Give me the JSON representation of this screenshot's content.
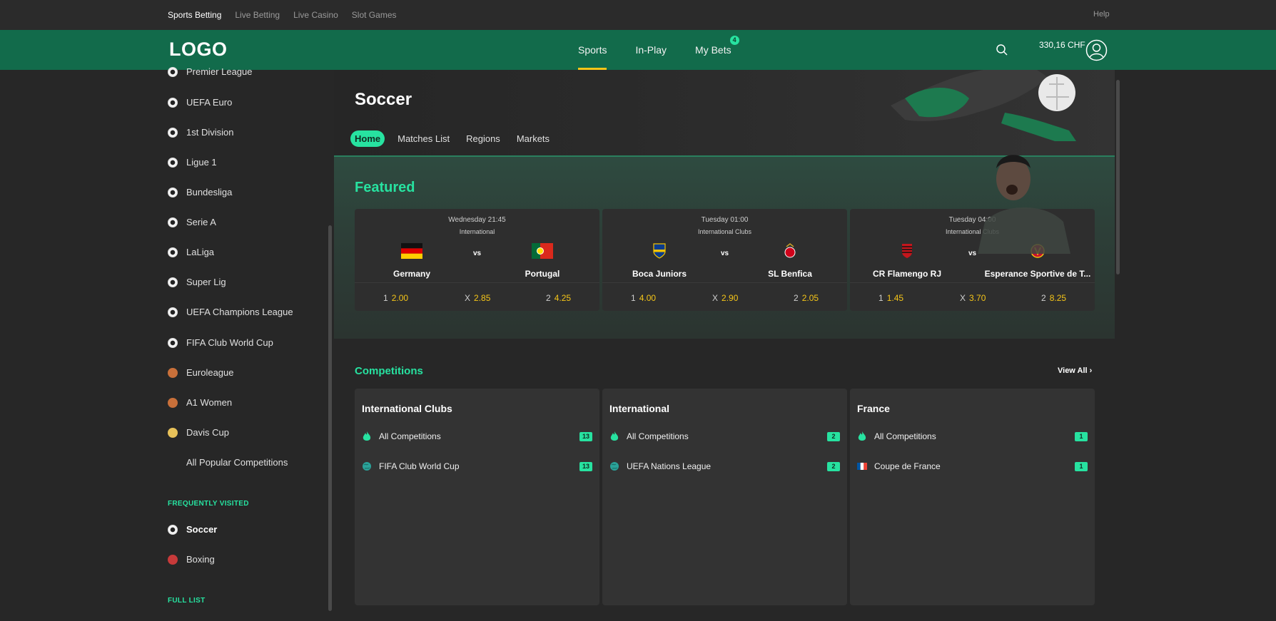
{
  "top_links": {
    "sports_betting": "Sports Betting",
    "live_betting": "Live Betting",
    "live_casino": "Live Casino",
    "slot_games": "Slot Games",
    "help": "Help"
  },
  "header": {
    "logo": "LOGO",
    "nav": [
      {
        "label": "Sports",
        "active": true
      },
      {
        "label": "In-Play",
        "active": false
      },
      {
        "label": "My Bets",
        "badge": "4"
      }
    ],
    "balance": "330,16 CHF"
  },
  "sidebar": {
    "items": [
      {
        "label": "Premier League",
        "icon": "soccer-ball-icon"
      },
      {
        "label": "UEFA Euro",
        "icon": "soccer-ball-icon"
      },
      {
        "label": "1st Division",
        "icon": "soccer-ball-icon"
      },
      {
        "label": "Ligue 1",
        "icon": "soccer-ball-icon"
      },
      {
        "label": "Bundesliga",
        "icon": "soccer-ball-icon"
      },
      {
        "label": "Serie A",
        "icon": "soccer-ball-icon"
      },
      {
        "label": "LaLiga",
        "icon": "soccer-ball-icon"
      },
      {
        "label": "Super Lig",
        "icon": "soccer-ball-icon"
      },
      {
        "label": "UEFA Champions League",
        "icon": "soccer-ball-icon"
      },
      {
        "label": "FIFA Club World Cup",
        "icon": "soccer-ball-icon"
      },
      {
        "label": "Euroleague",
        "icon": "basketball-icon"
      },
      {
        "label": "A1 Women",
        "icon": "basketball-icon"
      },
      {
        "label": "Davis Cup",
        "icon": "tennis-ball-icon"
      },
      {
        "label": "All Popular Competitions",
        "icon": ""
      }
    ],
    "frequently_visited_label": "FREQUENTLY VISITED",
    "frequent": [
      {
        "label": "Soccer",
        "icon": "soccer-ball-icon"
      },
      {
        "label": "Boxing",
        "icon": "boxing-glove-icon"
      }
    ],
    "full_list_label": "FULL LIST"
  },
  "page": {
    "title": "Soccer",
    "tabs": [
      {
        "label": "Home",
        "active": true
      },
      {
        "label": "Matches List"
      },
      {
        "label": "Regions"
      },
      {
        "label": "Markets"
      }
    ]
  },
  "featured": {
    "title": "Featured",
    "matches": [
      {
        "when": "Wednesday 21:45",
        "competition": "International",
        "home": "Germany",
        "away": "Portugal",
        "vs": "vs",
        "odds": [
          {
            "label": "1",
            "value": "2.00"
          },
          {
            "label": "X",
            "value": "2.85"
          },
          {
            "label": "2",
            "value": "4.25"
          }
        ]
      },
      {
        "when": "Tuesday 01:00",
        "competition": "International Clubs",
        "home": "Boca Juniors",
        "away": "SL Benfica",
        "vs": "vs",
        "odds": [
          {
            "label": "1",
            "value": "4.00"
          },
          {
            "label": "X",
            "value": "2.90"
          },
          {
            "label": "2",
            "value": "2.05"
          }
        ]
      },
      {
        "when": "Tuesday 04:00",
        "competition": "International Clubs",
        "home": "CR Flamengo RJ",
        "away": "Esperance Sportive de T...",
        "vs": "vs",
        "odds": [
          {
            "label": "1",
            "value": "1.45"
          },
          {
            "label": "X",
            "value": "3.70"
          },
          {
            "label": "2",
            "value": "8.25"
          }
        ]
      }
    ]
  },
  "competitions": {
    "title": "Competitions",
    "view_all": "View All",
    "cards": [
      {
        "title": "International Clubs",
        "rows": [
          {
            "label": "All Competitions",
            "count": "13",
            "icon": "flame-icon"
          },
          {
            "label": "FIFA Club World Cup",
            "count": "13",
            "icon": "globe-icon"
          }
        ]
      },
      {
        "title": "International",
        "rows": [
          {
            "label": "All Competitions",
            "count": "2",
            "icon": "flame-icon"
          },
          {
            "label": "UEFA Nations League",
            "count": "2",
            "icon": "globe-icon"
          }
        ]
      },
      {
        "title": "France",
        "rows": [
          {
            "label": "All Competitions",
            "count": "1",
            "icon": "flame-icon"
          },
          {
            "label": "Coupe de France",
            "count": "1",
            "icon": "france-flag-icon"
          }
        ]
      }
    ]
  },
  "colors": {
    "brand_green": "#126b4b",
    "accent": "#27e2a0",
    "odds_yellow": "#f5c518"
  }
}
